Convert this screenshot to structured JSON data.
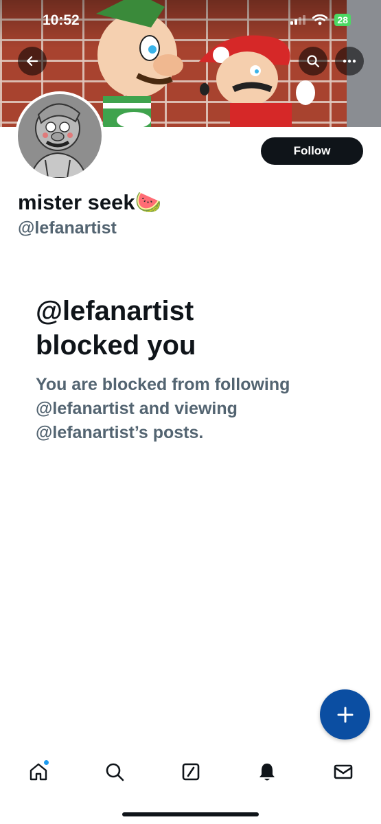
{
  "status_bar": {
    "time": "10:52",
    "battery": "28"
  },
  "header": {
    "back_icon": "arrow-left-icon",
    "search_icon": "search-icon",
    "more_icon": "more-horizontal-icon"
  },
  "profile": {
    "display_name": "mister seek🍉",
    "handle": "@lefanartist",
    "follow_label": "Follow"
  },
  "blocked": {
    "title_line1": "@lefanartist",
    "title_line2": "blocked you",
    "description": "You are blocked from following @lefanartist and viewing @lefanartist’s posts."
  },
  "fab": {
    "icon": "plus-icon"
  },
  "bottom_nav": {
    "items": [
      {
        "name": "home",
        "icon": "home-icon",
        "has_dot": true
      },
      {
        "name": "search",
        "icon": "search-icon"
      },
      {
        "name": "grok",
        "icon": "slash-square-icon"
      },
      {
        "name": "notifications",
        "icon": "bell-icon"
      },
      {
        "name": "messages",
        "icon": "mail-icon"
      }
    ]
  },
  "colors": {
    "accent": "#1d9bf0",
    "fab": "#0b4ea2",
    "text_primary": "#0f1419",
    "text_secondary": "#536471"
  }
}
